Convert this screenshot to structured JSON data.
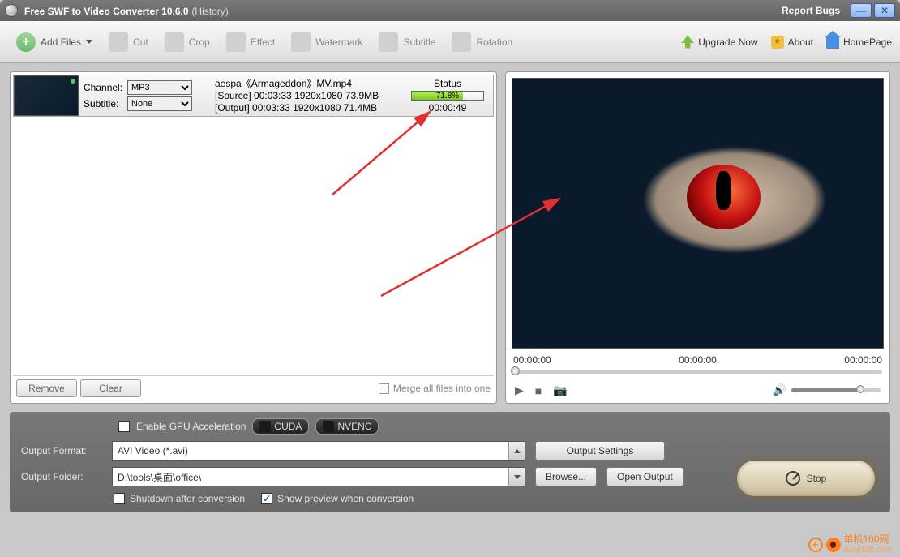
{
  "titlebar": {
    "title": "Free SWF to Video Converter 10.6.0",
    "history": "(History)",
    "report": "Report Bugs"
  },
  "toolbar": {
    "add": "Add Files",
    "cut": "Cut",
    "crop": "Crop",
    "effect": "Effect",
    "watermark": "Watermark",
    "subtitle": "Subtitle",
    "rotation": "Rotation",
    "upgrade": "Upgrade Now",
    "about": "About",
    "home": "HomePage"
  },
  "file": {
    "channel_lbl": "Channel:",
    "channel_val": "MP3",
    "subtitle_lbl": "Subtitle:",
    "subtitle_val": "None",
    "name": "aespa《Armageddon》MV.mp4",
    "src_line": "[Source]  00:03:33  1920x1080  73.9MB",
    "out_line": "[Output]  00:03:33  1920x1080  71.4MB",
    "status_lbl": "Status",
    "pct": "71.8%",
    "elapsed": "00:00:49"
  },
  "leftbottom": {
    "remove": "Remove",
    "clear": "Clear",
    "merge": "Merge all files into one"
  },
  "preview": {
    "t0": "00:00:00",
    "t1": "00:00:00",
    "t2": "00:00:00"
  },
  "bottom": {
    "gpu": "Enable GPU Acceleration",
    "cuda": "CUDA",
    "nvenc": "NVENC",
    "fmt_lbl": "Output Format:",
    "fmt_val": "AVI Video (*.avi)",
    "settings": "Output Settings",
    "folder_lbl": "Output Folder:",
    "folder_val": "D:\\tools\\桌面\\office\\",
    "browse": "Browse...",
    "open": "Open Output",
    "shutdown": "Shutdown after conversion",
    "showprev": "Show preview when conversion",
    "stop": "Stop"
  },
  "watermark": {
    "line1": "单机100网",
    "line2": "danji100.com"
  }
}
